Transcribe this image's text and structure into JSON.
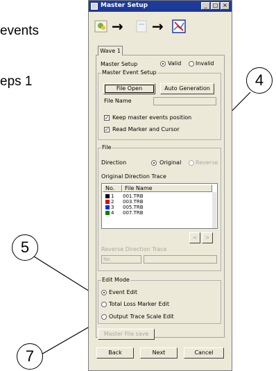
{
  "document": {
    "line1": "events",
    "line2": "eps 1",
    "callouts": [
      "4",
      "5",
      "7"
    ]
  },
  "window": {
    "title": "Master Setup",
    "controls": [
      "_",
      "□",
      "×"
    ],
    "wizard_icons": [
      "setup-icon",
      "arrow-right-icon",
      "document-icon",
      "arrow-right-icon",
      "chart-check-icon"
    ],
    "arrow_glyph": "→"
  },
  "tab": {
    "label": "Wave 1"
  },
  "master_setup": {
    "label": "Master Setup",
    "valid_label": "Valid",
    "invalid_label": "Invalid",
    "selected": "Valid"
  },
  "master_event_setup": {
    "title": "Master Event Setup",
    "file_open_label": "File Open",
    "auto_generation_label": "Auto Generation",
    "file_name_label": "File Name",
    "file_name_value": "",
    "keep_position_label": "Keep master events position",
    "keep_position_checked": true,
    "read_marker_label": "Read Marker and Cursor",
    "read_marker_checked": true
  },
  "file_group": {
    "title": "File",
    "direction_label": "Direction",
    "original_label": "Original",
    "reverse_label": "Reverse",
    "selected": "Original",
    "original_trace_label": "Original Direction Trace",
    "columns": [
      "No.",
      "File Name"
    ],
    "rows": [
      {
        "no": "1",
        "name": "001.TRB",
        "color": "#000000"
      },
      {
        "no": "2",
        "name": "003.TRB",
        "color": "#e00000"
      },
      {
        "no": "3",
        "name": "005.TRB",
        "color": "#0030e0"
      },
      {
        "no": "4",
        "name": "007.TRB",
        "color": "#008000"
      }
    ],
    "prev_label": "<",
    "next_label": ">",
    "reverse_trace_label": "Reverse Direction Trace",
    "reverse_no_value": "No."
  },
  "edit_mode": {
    "title": "Edit Mode",
    "options": [
      "Event Edit",
      "Total Loss Marker Edit",
      "Output Trace Scale Edit"
    ],
    "selected": "Event Edit"
  },
  "master_file_save_label": "Master File save",
  "footer": {
    "back_label": "Back",
    "next_label": "Next",
    "cancel_label": "Cancel"
  },
  "colors": {
    "titlebar": "#1f3c9a",
    "dialog_bg": "#ece9d8",
    "disabled_text": "#a8a8a8"
  }
}
